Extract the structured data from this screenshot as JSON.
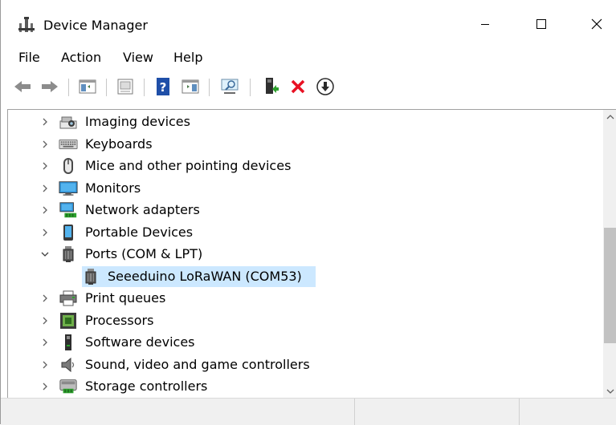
{
  "window": {
    "title": "Device Manager"
  },
  "menu": [
    {
      "label": "File"
    },
    {
      "label": "Action"
    },
    {
      "label": "View"
    },
    {
      "label": "Help"
    }
  ],
  "toolbar": {
    "buttons": [
      {
        "name": "back-icon"
      },
      {
        "name": "forward-icon"
      },
      {
        "name": "show-hide-console-tree-icon"
      },
      {
        "name": "properties-icon"
      },
      {
        "name": "help-icon"
      },
      {
        "name": "show-action-pane-icon"
      },
      {
        "name": "scan-hardware-changes-icon"
      },
      {
        "name": "update-driver-icon"
      },
      {
        "name": "uninstall-device-icon"
      },
      {
        "name": "download-icon"
      }
    ],
    "colors": {
      "uninstall": "#e81123",
      "help": "#1f4fa8"
    }
  },
  "tree": {
    "items": [
      {
        "label": "Imaging devices",
        "expanded": false,
        "icon": "camera-icon"
      },
      {
        "label": "Keyboards",
        "expanded": false,
        "icon": "keyboard-icon"
      },
      {
        "label": "Mice and other pointing devices",
        "expanded": false,
        "icon": "mouse-icon"
      },
      {
        "label": "Monitors",
        "expanded": false,
        "icon": "monitor-icon"
      },
      {
        "label": "Network adapters",
        "expanded": false,
        "icon": "network-adapter-icon"
      },
      {
        "label": "Portable Devices",
        "expanded": false,
        "icon": "portable-device-icon"
      },
      {
        "label": "Ports (COM & LPT)",
        "expanded": true,
        "icon": "port-icon"
      },
      {
        "label": "Seeeduino LoRaWAN (COM53)",
        "child": true,
        "selected": true,
        "icon": "port-icon"
      },
      {
        "label": "Print queues",
        "expanded": false,
        "icon": "printer-icon"
      },
      {
        "label": "Processors",
        "expanded": false,
        "icon": "processor-icon"
      },
      {
        "label": "Software devices",
        "expanded": false,
        "icon": "software-device-icon"
      },
      {
        "label": "Sound, video and game controllers",
        "expanded": false,
        "icon": "speaker-icon"
      },
      {
        "label": "Storage controllers",
        "expanded": false,
        "icon": "storage-controller-icon"
      }
    ]
  },
  "colors": {
    "selection": "#cce8ff",
    "statusbar": "#f0f0f0",
    "scroll_thumb": "#c2c2c2"
  }
}
